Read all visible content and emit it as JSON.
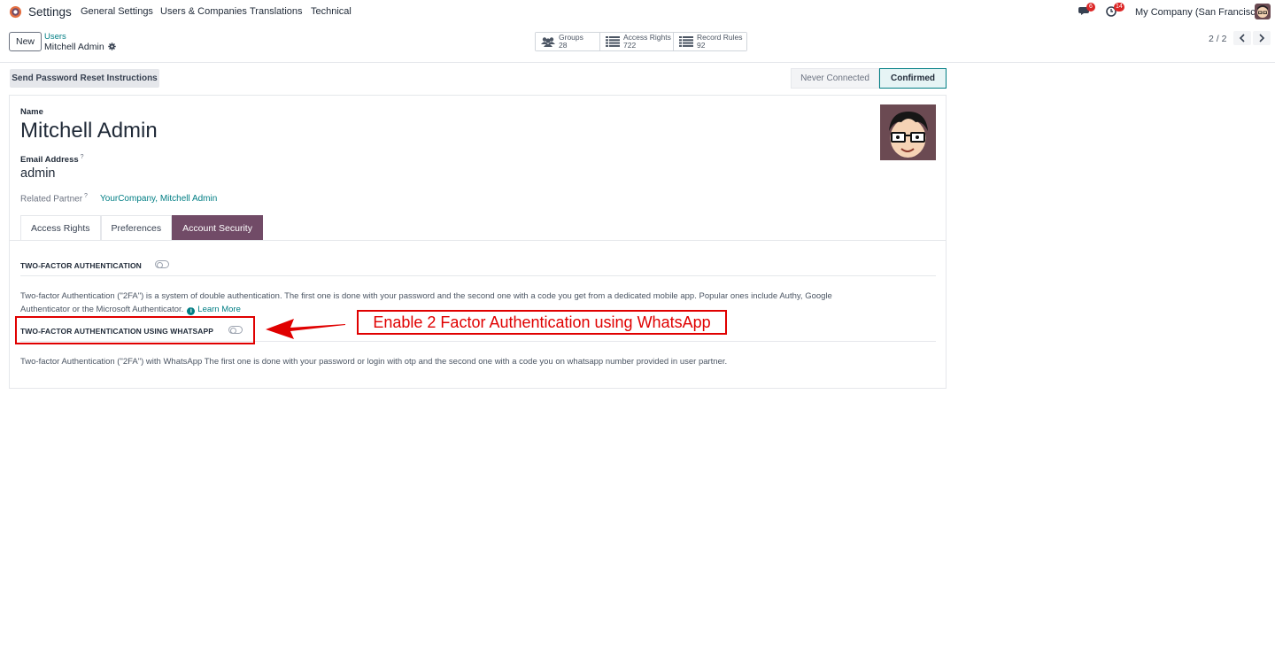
{
  "navbar": {
    "app_title": "Settings",
    "menu": [
      "General Settings",
      "Users & Companies",
      "Translations",
      "Technical"
    ],
    "messages_count": "6",
    "activities_count": "14",
    "company": "My Company (San Francisco)"
  },
  "control_panel": {
    "new_label": "New",
    "breadcrumb_parent": "Users",
    "breadcrumb_current": "Mitchell Admin",
    "stats": [
      {
        "label": "Groups",
        "value": "28",
        "icon": "users-icon"
      },
      {
        "label": "Access Rights",
        "value": "722",
        "icon": "list-icon"
      },
      {
        "label": "Record Rules",
        "value": "92",
        "icon": "list-icon"
      }
    ],
    "pager": "2 / 2"
  },
  "statusbar": {
    "action_label": "Send Password Reset Instructions",
    "stages": [
      "Never Connected",
      "Confirmed"
    ],
    "active_stage": "Confirmed"
  },
  "form": {
    "name_label": "Name",
    "name_value": "Mitchell Admin",
    "email_label": "Email Address",
    "help_mark": "?",
    "email_value": "admin",
    "related_label": "Related Partner",
    "related_value": "YourCompany, Mitchell Admin",
    "tabs": [
      "Access Rights",
      "Preferences",
      "Account Security"
    ],
    "active_tab": "Account Security",
    "security": {
      "tfa_title": "TWO-FACTOR AUTHENTICATION",
      "tfa_enabled": false,
      "tfa_desc_1": "Two-factor Authentication (\"2FA\") is a system of double authentication. The first one is done with your password and the second one with a code you get from a dedicated mobile app. Popular ones include Authy, Google",
      "tfa_desc_2": "Authenticator or the Microsoft Authenticator.",
      "info_glyph": "i",
      "learn_more": "Learn More",
      "wa_title": "TWO-FACTOR AUTHENTICATION USING WHATSAPP",
      "wa_enabled": false,
      "wa_desc": "Two-factor Authentication (\"2FA\") with WhatsApp The first one is done with your password or login with otp and the second one with a code you on whatsapp number provided in user partner."
    }
  },
  "annotation": {
    "callout": "Enable 2 Factor Authentication using WhatsApp",
    "color": "#e00000"
  },
  "colors": {
    "brand": "#714b67",
    "link": "#017e84"
  }
}
